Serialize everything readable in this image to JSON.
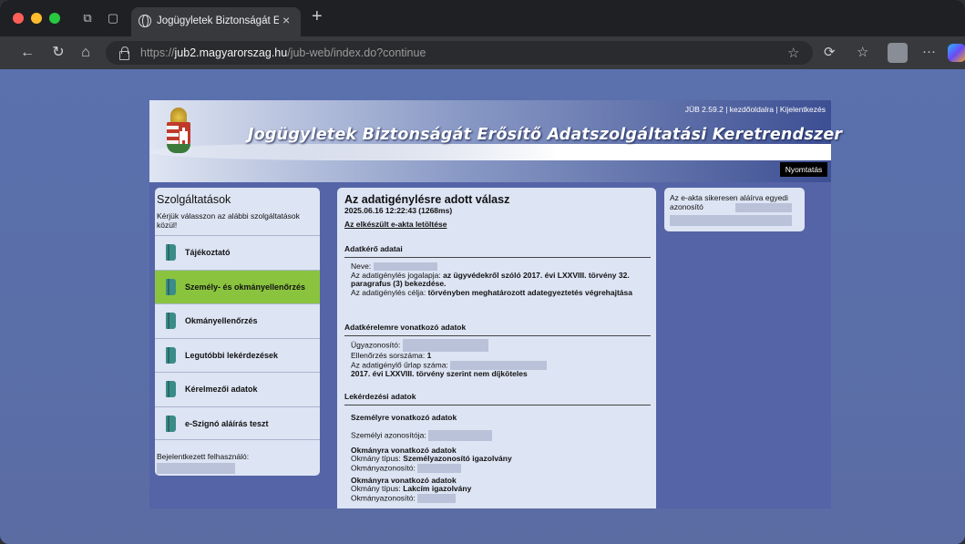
{
  "browser": {
    "tab_title": "Jogügyletek Biztonságát Erősít",
    "url_domain": "jub2.magyarorszag.hu",
    "url_scheme": "https://",
    "url_path": "/jub-web/index.do?continue"
  },
  "header": {
    "version": "JÜB 2.59.2",
    "home_link": "kezdőoldalra",
    "logout_link": "Kijelentkezés",
    "title": "Jogügyletek Biztonságát Erősítő Adatszolgáltatási Keretrendszer",
    "print_button": "Nyomtatás"
  },
  "sidebar": {
    "title": "Szolgáltatások",
    "intro": "Kérjük válasszon az alábbi szolgáltatások közül!",
    "items": [
      {
        "label": "Tájékoztató",
        "active": false
      },
      {
        "label": "Személy- és okmányellenőrzés",
        "active": true
      },
      {
        "label": "Okmányellenőrzés",
        "active": false
      },
      {
        "label": "Legutóbbi lekérdezések",
        "active": false
      },
      {
        "label": "Kérelmezői adatok",
        "active": false
      },
      {
        "label": "e-Szignó aláírás teszt",
        "active": false
      }
    ],
    "logged_in_label": "Bejelentkezett felhasználó:"
  },
  "main": {
    "title": "Az adatigénylésre adott válasz",
    "timestamp": "2025.06.16 12:22:43 (1268ms)",
    "download_link": "Az elkészült e-akta letöltése",
    "requester_section": "Adatkérő adatai",
    "name_label": "Neve:",
    "legal_basis_label": "Az adatigénylés jogalapja:",
    "legal_basis_value": "az ügyvédekről szóló 2017. évi LXXVIII. törvény 32. paragrafus (3) bekezdése.",
    "purpose_label": "Az adatigénylés célja:",
    "purpose_value": "törvényben meghatározott adategyeztetés végrehajtása",
    "request_section": "Adatkérelemre vonatkozó adatok",
    "case_id_label": "Ügyazonosító:",
    "check_no_label": "Ellenőrzés sorszáma:",
    "check_no_value": "1",
    "form_no_label": "Az adatigénylő űrlap száma:",
    "fee_note": "2017. évi LXXVIII. törvény szerint nem díjköteles",
    "query_section": "Lekérdezési adatok",
    "person_section": "Személyre vonatkozó adatok",
    "person_id_label": "Személyi azonosítója:",
    "doc1_heading": "Okmányra vonatkozó adatok",
    "doc1_type_label": "Okmány típus:",
    "doc1_type_value": "Személyazonosító igazolvány",
    "doc1_id_label": "Okmányazonosító:",
    "doc2_heading": "Okmányra vonatkozó adatok",
    "doc2_type_label": "Okmány típus:",
    "doc2_type_value": "Lakcím igazolvány",
    "doc2_id_label": "Okmányazonosító:"
  },
  "notice": {
    "text": "Az e-akta sikeresen aláírva egyedi azonosító"
  },
  "colors": {
    "page_bg": "#5a71ae",
    "panel_bg": "#dde4f3",
    "active_item": "#8ac43f"
  }
}
